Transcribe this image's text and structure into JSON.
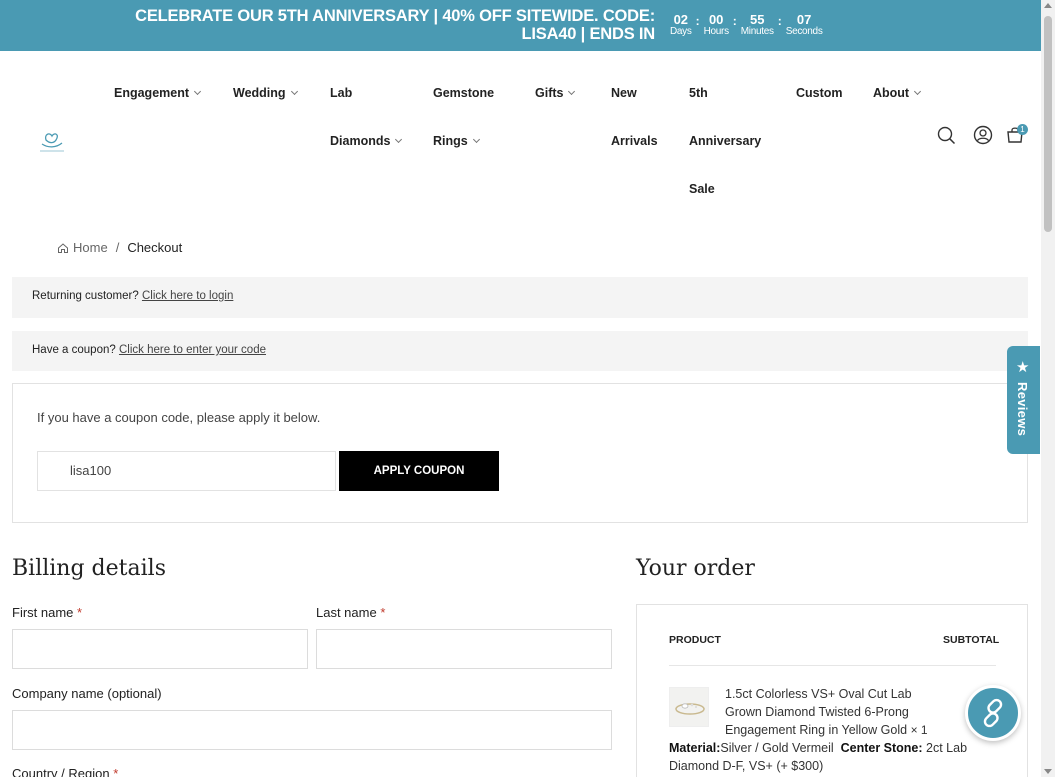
{
  "announcement": {
    "line1": "CELEBRATE OUR 5TH ANNIVERSARY | 40% OFF SITEWIDE. CODE:",
    "line2": "LISA40 | ENDS IN",
    "countdown": [
      {
        "value": "02",
        "label": "Days"
      },
      {
        "value": "00",
        "label": "Hours"
      },
      {
        "value": "55",
        "label": "Minutes"
      },
      {
        "value": "07",
        "label": "Seconds"
      }
    ],
    "separator": ":"
  },
  "nav": {
    "engagement": "Engagement",
    "wedding": "Wedding",
    "lab_line1": "Lab",
    "lab_line2": "Diamonds",
    "gemstone_line1": "Gemstone",
    "gemstone_line2": "Rings",
    "gifts": "Gifts",
    "new_line1": "New",
    "new_line2": "Arrivals",
    "anniv_line1": "5th",
    "anniv_line2": "Anniversary",
    "anniv_line3": "Sale",
    "custom": "Custom",
    "about": "About"
  },
  "header_icons": [
    "search-icon",
    "account-icon",
    "cart-icon"
  ],
  "cart": {
    "count": "1"
  },
  "breadcrumb": {
    "home": "Home",
    "separator": "/",
    "current": "Checkout"
  },
  "notices": {
    "returning": {
      "text": "Returning customer?",
      "link": "Click here to login"
    },
    "coupon": {
      "text": "Have a coupon?",
      "link": "Click here to enter your code"
    }
  },
  "coupon_form": {
    "instructions": "If you have a coupon code, please apply it below.",
    "input_value": "lisa100",
    "button": "APPLY COUPON"
  },
  "billing": {
    "title": "Billing details",
    "first_name": "First name",
    "last_name": "Last name",
    "company": "Company name (optional)",
    "country": "Country / Region",
    "required_mark": "*"
  },
  "order": {
    "title": "Your order",
    "col_product": "PRODUCT",
    "col_subtotal": "SUBTOTAL",
    "product_name": "1.5ct Colorless VS+ Oval Cut Lab Grown Diamond Twisted 6-Prong Engagement Ring in Yellow Gold",
    "quantity": "× 1",
    "meta": [
      {
        "key": "Material:",
        "value": "Silver / Gold Vermeil"
      },
      {
        "key": "Center Stone:",
        "value": "2ct Lab Diamond D-F, VS+ (+ $300)"
      }
    ]
  },
  "reviews_tab": {
    "label": "Reviews",
    "icon": "star-icon"
  },
  "colors": {
    "accent": "#4a9ab3",
    "button": "#000000",
    "notice_bg": "#f4f4f4"
  }
}
